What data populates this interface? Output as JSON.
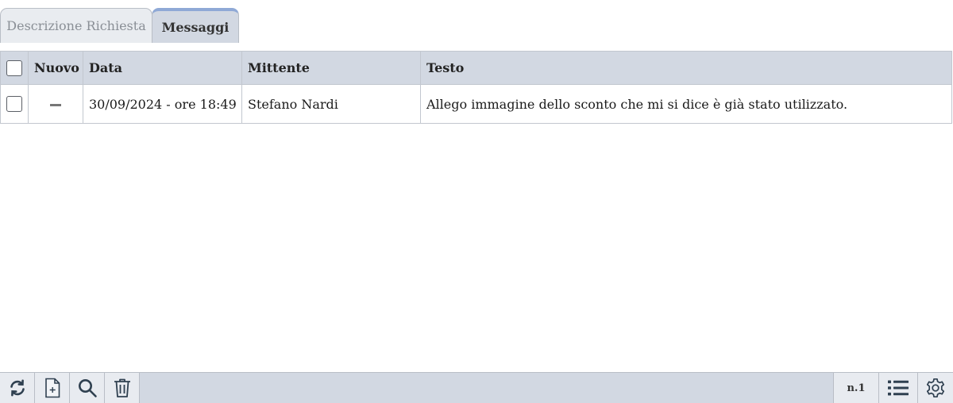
{
  "tabs": [
    {
      "label": "Descrizione Richiesta",
      "active": false
    },
    {
      "label": "Messaggi",
      "active": true
    }
  ],
  "table": {
    "columns": [
      "Nuovo",
      "Data",
      "Mittente",
      "Testo"
    ],
    "rows": [
      {
        "checked": false,
        "nuovo": "—",
        "data": "30/09/2024 - ore 18:49",
        "mittente": "Stefano Nardi",
        "testo": "Allego immagine dello sconto che mi si dice è già stato utilizzato."
      }
    ]
  },
  "toolbar": {
    "buttons": [
      "refresh-icon",
      "new-document-icon",
      "search-icon",
      "trash-icon"
    ],
    "record_count": "n.1",
    "right_buttons": [
      "list-icon",
      "gear-icon"
    ]
  },
  "colors": {
    "header_bg": "#d2d8e2",
    "active_tab_accent": "#8fa9d6",
    "icon_color": "#2f4050"
  }
}
